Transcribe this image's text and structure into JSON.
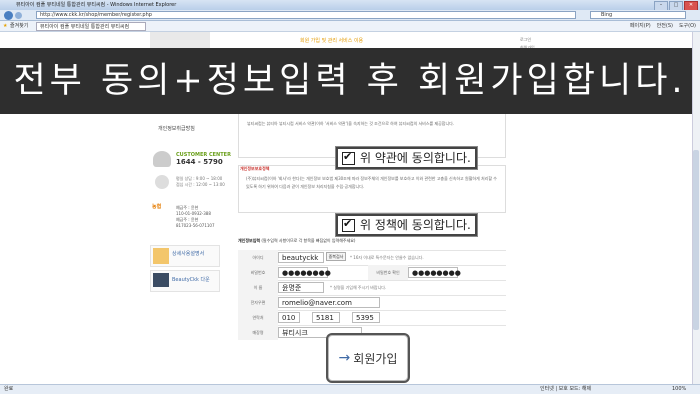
{
  "browser": {
    "title": "뷰티아이 컴플 뷰티네일 통합관리 뷰티씨컴 - Windows Internet Explorer",
    "address": "http://www.ckk.kr/shop/member/register.php",
    "search_placeholder": "Bing",
    "favorites_label": "즐겨찾기",
    "tab_label": "뷰티아이 컴플 뷰티네일 통합관리 뷰티씨컴",
    "toolbar_items": [
      "페이지(P)",
      "안전(S)",
      "도구(O)"
    ],
    "status_left": "완료",
    "status_right": "인터넷 | 보호 모드: 해제",
    "zoom": "100%"
  },
  "overlay": {
    "headline": "전부 동의+정보입력 후 회원가입합니다."
  },
  "callouts": {
    "agree_terms": "위 약관에 동의합니다.",
    "agree_privacy": "위 정책에 동의합니다."
  },
  "sidebar": {
    "menu_item": "개인정보취급방침",
    "cs_title": "CUSTOMER CENTER",
    "cs_phone": "1644 - 5790",
    "hours": [
      "평일 상담 : 9:00 ~ 18:00",
      "점심 시간 : 12:00 ~ 13:00"
    ],
    "bank_logo": "농협",
    "bank_info": [
      "예금주 : 윤현",
      "110-01-0932-388",
      "예금주 : 윤현",
      "817023-56-071107"
    ],
    "card1_label": "상세사용설명서",
    "card2_label": "BeautyCkk 다운"
  },
  "terms": {
    "text": "뷰티씨컴는 뷰티아 뷰티시컴 서비스 약관(이하 '서비스 약관')을 숙지하는 것 조건으로 하여 뷰티씨컴의 서비스를 제공합니다."
  },
  "privacy": {
    "title": "개인정보보호정책",
    "text": "(주)뷰티씨컴(이하 '회사'라 한다)는 개인정보 보호법 제30조에 따라 정보주체의 개인정보를 보호하고 이와 관련한 고충을 신속하고 원활하게 처리할 수 있도록 하기 위하여 다음과 같이 개인정보 처리지침을 수립·공개합니다."
  },
  "form": {
    "section_title": "개인정보입력",
    "section_hint": "(필수입력 사항이므로 각 항목을 빠짐없이 입력해주세요)",
    "fields": {
      "id_label": "아이디",
      "id_value": "beautyckk",
      "id_check_button": "중복검사",
      "id_hint": "* 16자 이내로 특수문자는 안쓸수 없습니다.",
      "pw_label": "비밀번호",
      "pw_value": "●●●●●●●●",
      "pw_confirm_label": "비밀번호 확인",
      "pw_confirm_value": "●●●●●●●●",
      "name_label": "이 름",
      "name_value": "윤명준",
      "name_hint": "* 실명을 기입해 주시기 바랍니다.",
      "email_label": "전자우편",
      "email_value": "romelio@naver.com",
      "phone_label": "연락처",
      "phone_1": "010",
      "phone_2": "5181",
      "phone_3": "5395",
      "shop_label": "매장명",
      "shop_value": "뷰티시크"
    }
  },
  "join_button": "회원가입",
  "header": {
    "banner": "회원 가입 및 관리 서비스 이용"
  },
  "right_nav": [
    "로그인",
    "회원가입",
    "마이페이지"
  ]
}
